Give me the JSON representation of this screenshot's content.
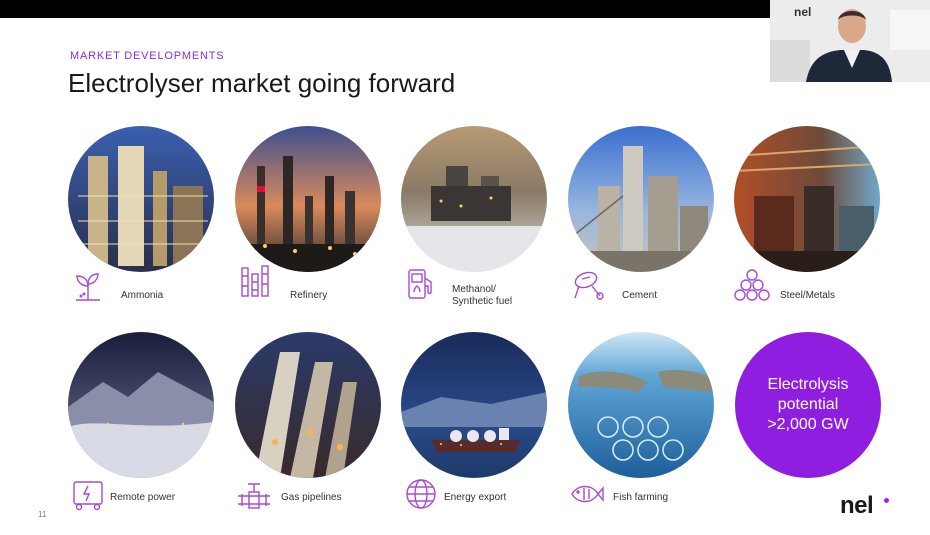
{
  "header": {
    "eyebrow": "MARKET DEVELOPMENTS",
    "title": "Electrolyser market going forward"
  },
  "sectors_row1": [
    {
      "label": "Ammonia",
      "icon": "sprout-icon"
    },
    {
      "label": "Refinery",
      "icon": "refinery-towers-icon"
    },
    {
      "label": "Methanol/",
      "label2": "Synthetic fuel",
      "icon": "fuel-pump-icon"
    },
    {
      "label": "Cement",
      "icon": "cement-mixer-icon"
    },
    {
      "label": "Steel/Metals",
      "icon": "stacked-circles-icon"
    }
  ],
  "sectors_row2": [
    {
      "label": "Remote power",
      "icon": "generator-icon"
    },
    {
      "label": "Gas pipelines",
      "icon": "pipeline-valve-icon"
    },
    {
      "label": "Energy export",
      "icon": "globe-icon"
    },
    {
      "label": "Fish farming",
      "icon": "fish-icon"
    }
  ],
  "potential": {
    "line1": "Electrolysis",
    "line2": "potential",
    "line3": ">2,000 GW"
  },
  "footer": {
    "page_number": "11",
    "logo": "nel"
  },
  "webcam": {
    "logo": "nel"
  },
  "colors": {
    "accent": "#8f1ee0",
    "eyebrow": "#8a2be2",
    "icon": "#a64ad6"
  }
}
